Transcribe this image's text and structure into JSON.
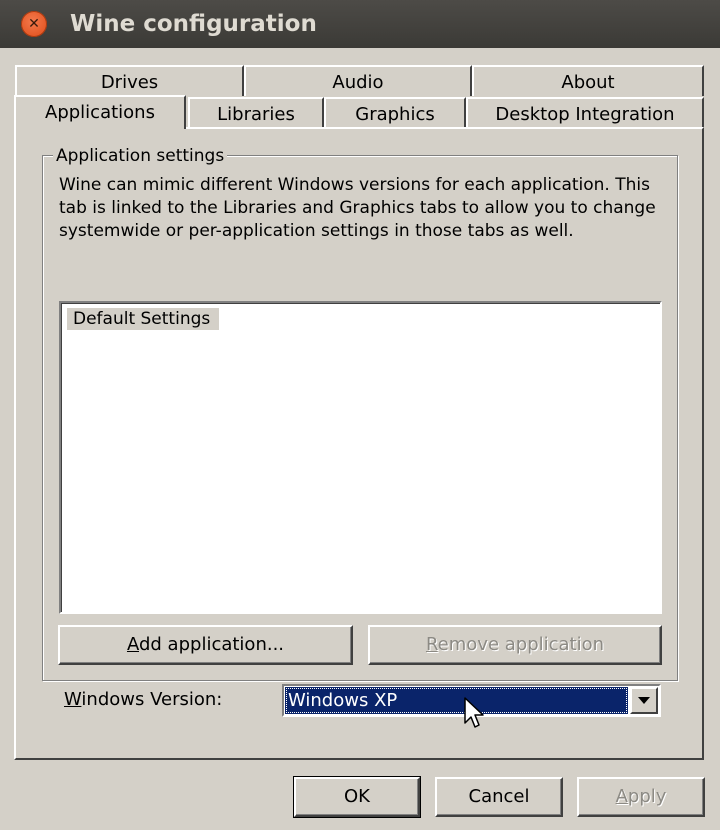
{
  "window": {
    "title": "Wine configuration",
    "close_icon": "close-icon"
  },
  "tabs": {
    "row1": [
      "Drives",
      "Audio",
      "About"
    ],
    "row2": [
      "Applications",
      "Libraries",
      "Graphics",
      "Desktop Integration"
    ],
    "active": "Applications"
  },
  "app_settings": {
    "legend": "Application settings",
    "description": "Wine can mimic different Windows versions for each application. This tab is linked to the Libraries and Graphics tabs to allow you to change systemwide or per-application settings in those tabs as well.",
    "list_items": [
      "Default Settings"
    ],
    "add_button": {
      "accel": "A",
      "rest": "dd application..."
    },
    "remove_button": {
      "accel": "R",
      "rest": "emove application",
      "disabled": true
    },
    "windows_version_label": {
      "accel": "W",
      "rest": "indows Version:"
    },
    "windows_version_value": "Windows XP"
  },
  "footer": {
    "ok": "OK",
    "cancel": "Cancel",
    "apply": {
      "accel": "A",
      "rest": "pply",
      "disabled": true
    }
  },
  "colors": {
    "window_bg": "#d4d0c8",
    "titlebar": "#3c3b37",
    "close_button": "#e2501d",
    "selection": "#0a246a"
  }
}
